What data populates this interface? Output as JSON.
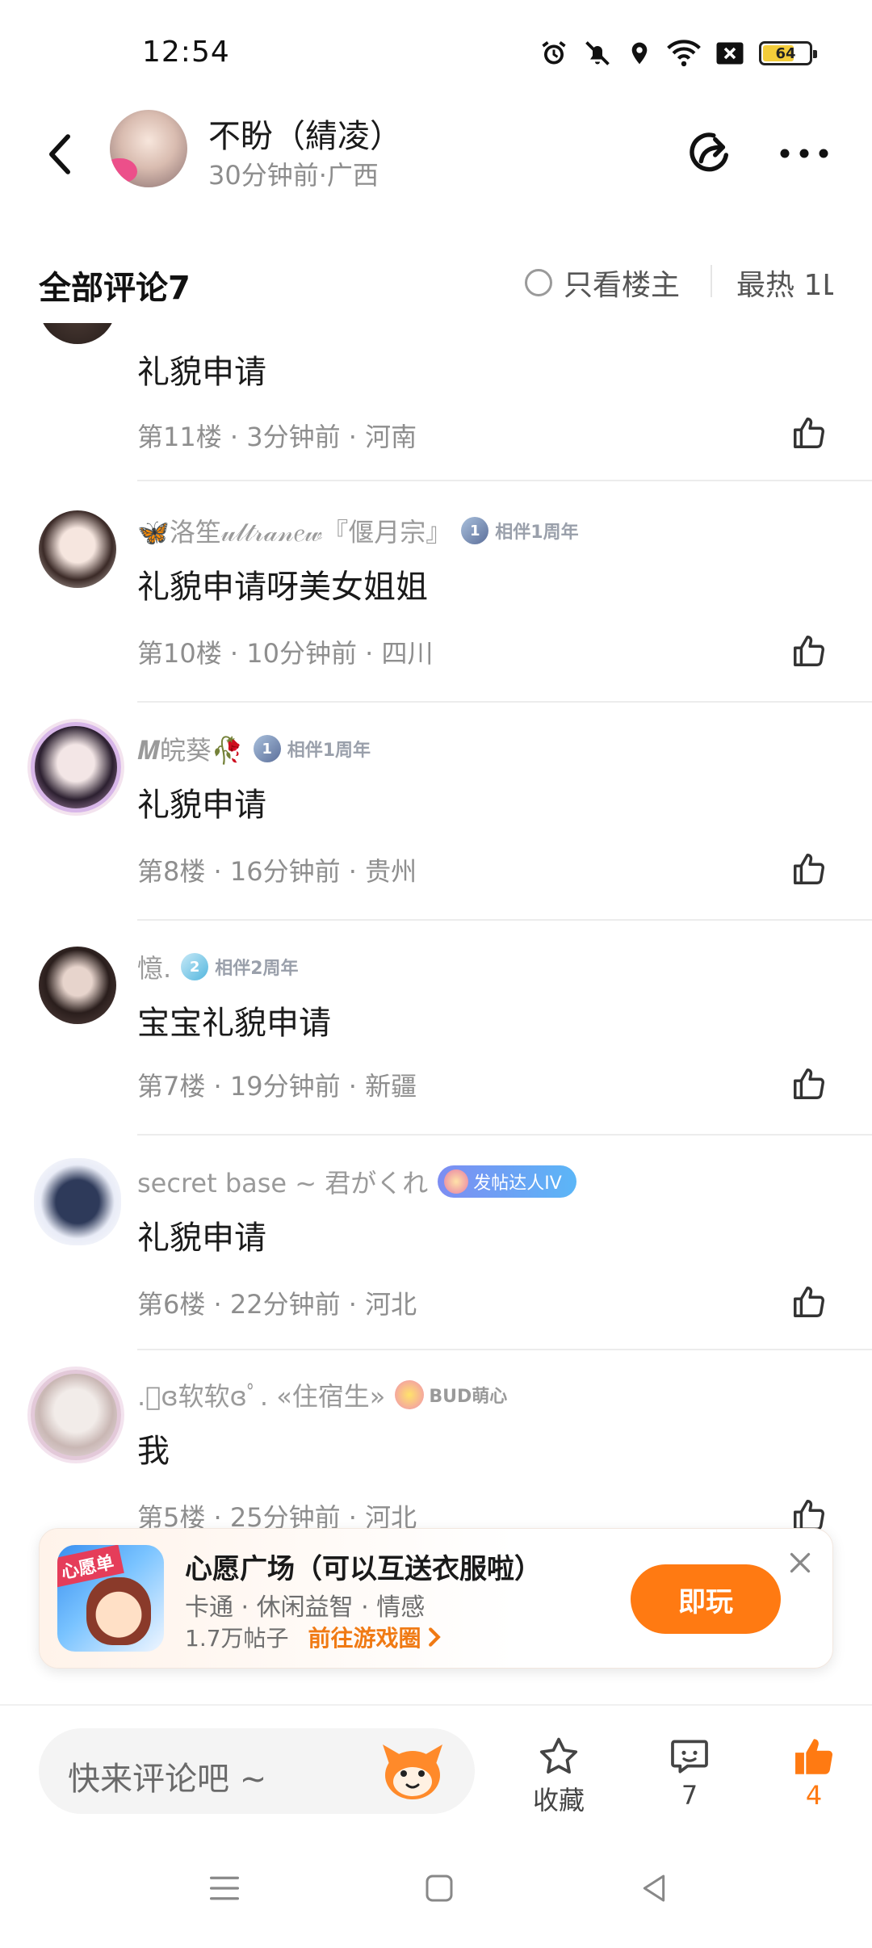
{
  "status_bar": {
    "time": "12:54",
    "battery_level": "64",
    "icons": [
      "alarm-icon",
      "mute-icon",
      "location-icon",
      "wifi-icon",
      "sim-off-icon",
      "battery-icon"
    ]
  },
  "header": {
    "author_name": "不盼（綪凌）",
    "author_meta": "30分钟前·广西",
    "icons": [
      "back-arrow-icon",
      "share-icon",
      "more-icon"
    ]
  },
  "comments_header": {
    "title": "全部评论7",
    "only_op_label": "只看楼主",
    "sort_label": "最热 1L"
  },
  "comments": [
    {
      "name": "",
      "text": "礼貌申请",
      "meta": "第11楼 · 3分钟前 · 河南"
    },
    {
      "name": "🦋洛笙𝓊𝓁𝓉𝓇𝒶𝓃𝑒𝓌『偃月宗』",
      "badge": "相伴1周年",
      "badge_num": "1",
      "text": "礼貌申请呀美女姐姐",
      "meta": "第10楼 · 10分钟前 · 四川"
    },
    {
      "name": "𝑴皖葵🥀",
      "badge": "相伴1周年",
      "badge_num": "1",
      "text": "礼貌申请",
      "meta": "第8楼 · 16分钟前 · 贵州"
    },
    {
      "name": "憶.",
      "badge": "相伴2周年",
      "badge_num": "2",
      "text": "宝宝礼貌申请",
      "meta": "第7楼 · 19分钟前 · 新疆"
    },
    {
      "name": "secret base ~ 君がくれ",
      "badge": "发帖达人IV",
      "text": "礼貌申请",
      "meta": "第6楼 · 22分钟前 · 河北"
    },
    {
      "name": ".ﾟɞ软软ɞﾟ. «住宿生»",
      "badge": "BUD萌心",
      "text": "我",
      "meta": "第5楼 · 25分钟前 · 河北"
    }
  ],
  "ad": {
    "icon_tag": "心愿单",
    "title": "心愿广场（可以互送衣服啦）",
    "tags": "卡通 · 休闲益智 · 情感",
    "posts": "1.7万帖子",
    "link": "前往游戏圈",
    "play_label": "即玩"
  },
  "bottom_bar": {
    "input_placeholder": "快来评论吧 ~",
    "fav_label": "收藏",
    "comment_count": "7",
    "like_count": "4"
  },
  "colors": {
    "accent": "#ff7a12",
    "meta_text": "#8e8e8e"
  }
}
